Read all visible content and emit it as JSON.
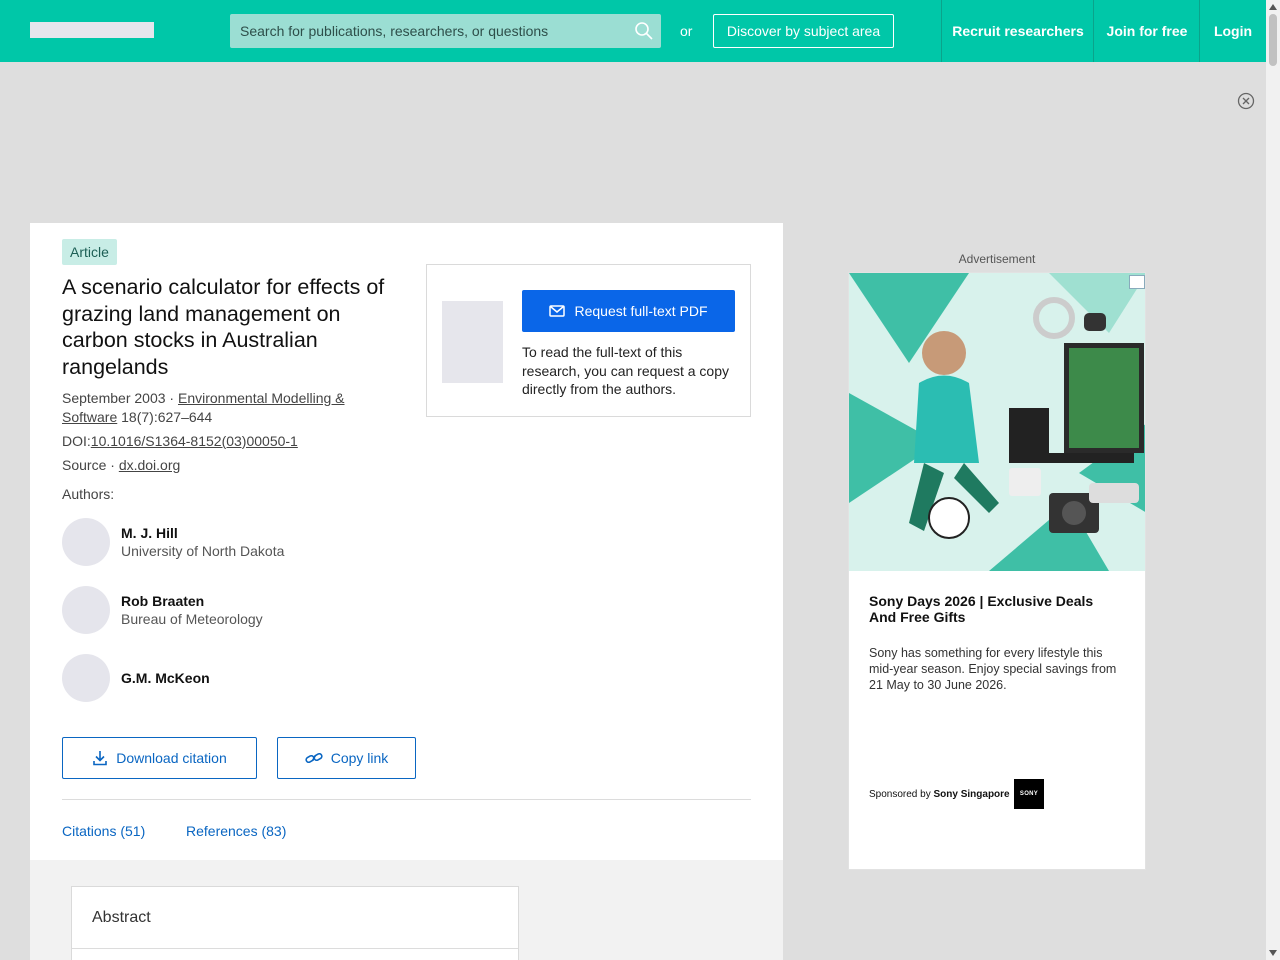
{
  "header": {
    "search_placeholder": "Search for publications, researchers, or questions",
    "or_text": "or",
    "discover_label": "Discover by subject area",
    "recruit_label": "Recruit researchers",
    "join_label": "Join for free",
    "login_label": "Login"
  },
  "article": {
    "badge": "Article",
    "title": "A scenario calculator for effects of grazing land management on carbon stocks in Australian rangelands",
    "date": "September 2003",
    "journal": "Environmental Modelling & Software",
    "volume": "18(7):627–644",
    "doi_prefix": "DOI:",
    "doi": "10.1016/S1364-8152(03)00050-1",
    "source_prefix": "Source · ",
    "source": "dx.doi.org",
    "authors_label": "Authors:",
    "authors": [
      {
        "name": "M. J. Hill",
        "affiliation": "University of North Dakota"
      },
      {
        "name": "Rob Braaten",
        "affiliation": "Bureau of Meteorology"
      },
      {
        "name": "G.M. McKeon",
        "affiliation": ""
      }
    ],
    "download_citation": "Download citation",
    "copy_link": "Copy link",
    "tabs": {
      "citations": "Citations (51)",
      "references": "References (83)"
    },
    "request_button": "Request full-text PDF",
    "request_text": "To read the full-text of this research, you can request a copy directly from the authors.",
    "abstract_title": "Abstract"
  },
  "ad": {
    "label": "Advertisement",
    "headline": "Sony Days 2026 | Exclusive Deals And Free Gifts",
    "body": "Sony has something for every lifestyle this mid-year season. Enjoy special savings from 21 May to 30 June 2026.",
    "sponsored_prefix": "Sponsored by ",
    "sponsor": "Sony Singapore",
    "logo_text": "SONY"
  },
  "colors": {
    "brand": "#00c7a8",
    "link": "#0a66c2",
    "primary_button": "#0a66e8"
  }
}
